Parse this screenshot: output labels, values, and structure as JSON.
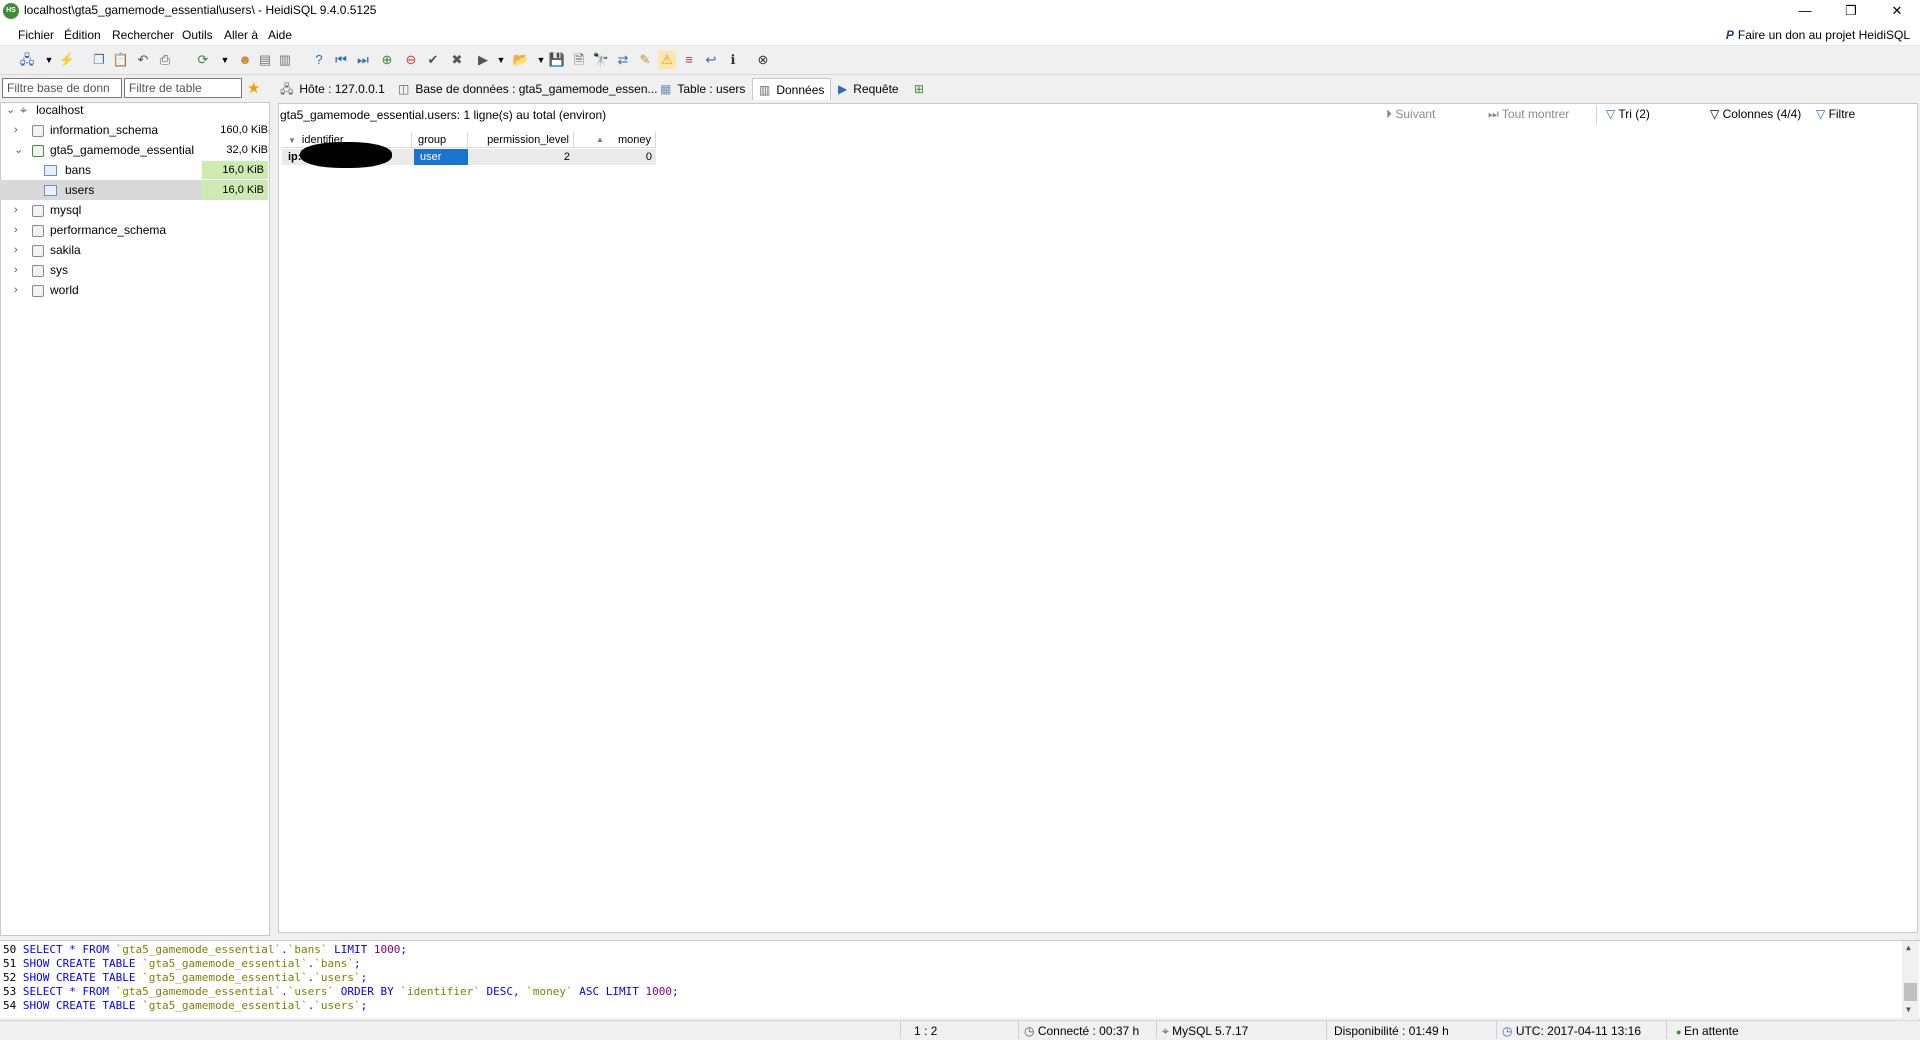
{
  "window": {
    "title": "localhost\\gta5_gamemode_essential\\users\\ - HeidiSQL 9.4.0.5125",
    "app_icon_text": "HS",
    "minimize": "—",
    "maximize": "❐",
    "close": "✕"
  },
  "menu": {
    "items": [
      "Fichier",
      "Édition",
      "Rechercher",
      "Outils",
      "Aller à",
      "Aide"
    ],
    "donate": "Faire un don au projet HeidiSQL"
  },
  "toolbar_icons": [
    "connect-icon",
    "dropdown-icon",
    "disconnect-icon",
    "copy-icon",
    "paste-icon",
    "undo-icon",
    "print-icon",
    "refresh-icon",
    "dropdown-icon",
    "user-manager-icon",
    "export-icon",
    "import-icon",
    "help-icon",
    "first-record-icon",
    "last-record-icon",
    "add-record-icon",
    "delete-record-icon",
    "post-icon",
    "cancel-icon",
    "run-icon",
    "dropdown-icon",
    "load-sql-icon",
    "dropdown-icon",
    "save-icon",
    "save-as-icon",
    "find-icon",
    "replace-icon",
    "explain-icon",
    "warning-icon",
    "log-icon",
    "wrap-icon",
    "info-icon",
    "stop-icon"
  ],
  "filters": {
    "db_placeholder": "Filtre base de donn",
    "table_placeholder": "Filtre de table"
  },
  "tree": {
    "root": "localhost",
    "databases": [
      {
        "name": "information_schema",
        "size": "160,0 KiB"
      },
      {
        "name": "gta5_gamemode_essential",
        "size": "32,0 KiB"
      },
      {
        "name": "mysql",
        "size": ""
      },
      {
        "name": "performance_schema",
        "size": ""
      },
      {
        "name": "sakila",
        "size": ""
      },
      {
        "name": "sys",
        "size": ""
      },
      {
        "name": "world",
        "size": ""
      }
    ],
    "tables": [
      {
        "name": "bans",
        "size": "16,0 KiB"
      },
      {
        "name": "users",
        "size": "16,0 KiB"
      }
    ]
  },
  "tabs": [
    {
      "label": "Hôte : 127.0.0.1"
    },
    {
      "label": "Base de données : gta5_gamemode_essen..."
    },
    {
      "label": "Table : users"
    },
    {
      "label": "Données"
    },
    {
      "label": "Requête"
    }
  ],
  "data_view": {
    "row_info": "gta5_gamemode_essential.users: 1 ligne(s) au total (environ)",
    "next": "Suivant",
    "show_all": "Tout montrer",
    "sort": "Tri (2)",
    "columns": "Colonnes (4/4)",
    "filter": "Filtre",
    "headers": [
      "identifier",
      "group",
      "permission_level",
      "money"
    ],
    "rows": [
      {
        "identifier": "ip:",
        "group": "user",
        "permission_level": "2",
        "money": "0"
      }
    ]
  },
  "log": {
    "lines": [
      {
        "n": "50",
        "sql": "SELECT * FROM `gta5_gamemode_essential`.`bans` LIMIT 1000;"
      },
      {
        "n": "51",
        "sql": "SHOW CREATE TABLE `gta5_gamemode_essential`.`bans`;"
      },
      {
        "n": "52",
        "sql": "SHOW CREATE TABLE `gta5_gamemode_essential`.`users`;"
      },
      {
        "n": "53",
        "sql": "SELECT * FROM `gta5_gamemode_essential`.`users` ORDER BY `identifier` DESC, `money` ASC LIMIT 1000;"
      },
      {
        "n": "54",
        "sql": "SHOW CREATE TABLE `gta5_gamemode_essential`.`users`;"
      }
    ]
  },
  "status": {
    "position": "1 : 2",
    "connected": "Connecté : 00:37 h",
    "server": "MySQL 5.7.17",
    "uptime": "Disponibilité : 01:49 h",
    "utc": "UTC: 2017-04-11 13:16",
    "state": "En attente"
  }
}
